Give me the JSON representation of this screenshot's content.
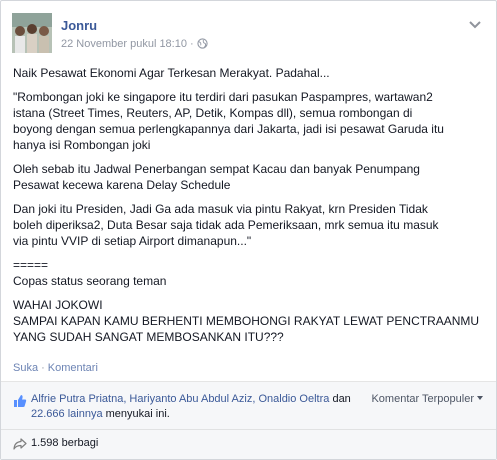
{
  "post": {
    "author": "Jonru",
    "timestamp": "22 November pukul 18:10",
    "separator": "·",
    "privacy_icon": "globe-icon",
    "options_icon": "chevron-down-icon",
    "paragraphs": [
      "Naik Pesawat Ekonomi Agar Terkesan Merakyat. Padahal...",
      "\"Rombongan joki ke singapore itu terdiri dari pasukan Paspampres, wartawan2\nistana (Street Times, Reuters, AP, Detik, Kompas dll), semua rombongan di\nboyong dengan semua perlengkapannya dari Jakarta, jadi isi pesawat Garuda itu\nhanya isi Rombongan joki",
      "Oleh sebab itu Jadwal Penerbangan sempat Kacau dan banyak Penumpang\nPesawat kecewa karena Delay Schedule",
      "Dan joki itu Presiden, Jadi Ga ada masuk via pintu Rakyat, krn Presiden Tidak\nboleh diperiksa2, Duta Besar saja tidak ada Pemeriksaan, mrk semua itu masuk\nvia pintu VVIP di setiap Airport dimanapun...\"",
      "=====",
      "Copas status seorang teman",
      "WAHAI JOKOWI\nSAMPAI KAPAN KAMU BERHENTI MEMBOHONGI RAKYAT LEWAT PENCTRAANMU\nYANG SUDAH SANGAT MEMBOSANKAN ITU???"
    ]
  },
  "actions": {
    "like": "Suka",
    "separator": "·",
    "comment": "Komentari"
  },
  "likes": {
    "icon": "thumbs-up-icon",
    "names": "Alfrie Putra Priatna, Hariyanto Abu Abdul Aziz, Onaldio Oeltra",
    "connector": " dan ",
    "others": "22.666 lainnya",
    "suffix": " menyukai ini."
  },
  "comments_sort": {
    "label": "Komentar Terpopuler"
  },
  "shares": {
    "icon": "share-arrow-icon",
    "label": "1.598 berbagi"
  },
  "colors": {
    "link": "#3b5998",
    "meta": "#9197a3",
    "ufi_background": "#f6f7f9"
  }
}
